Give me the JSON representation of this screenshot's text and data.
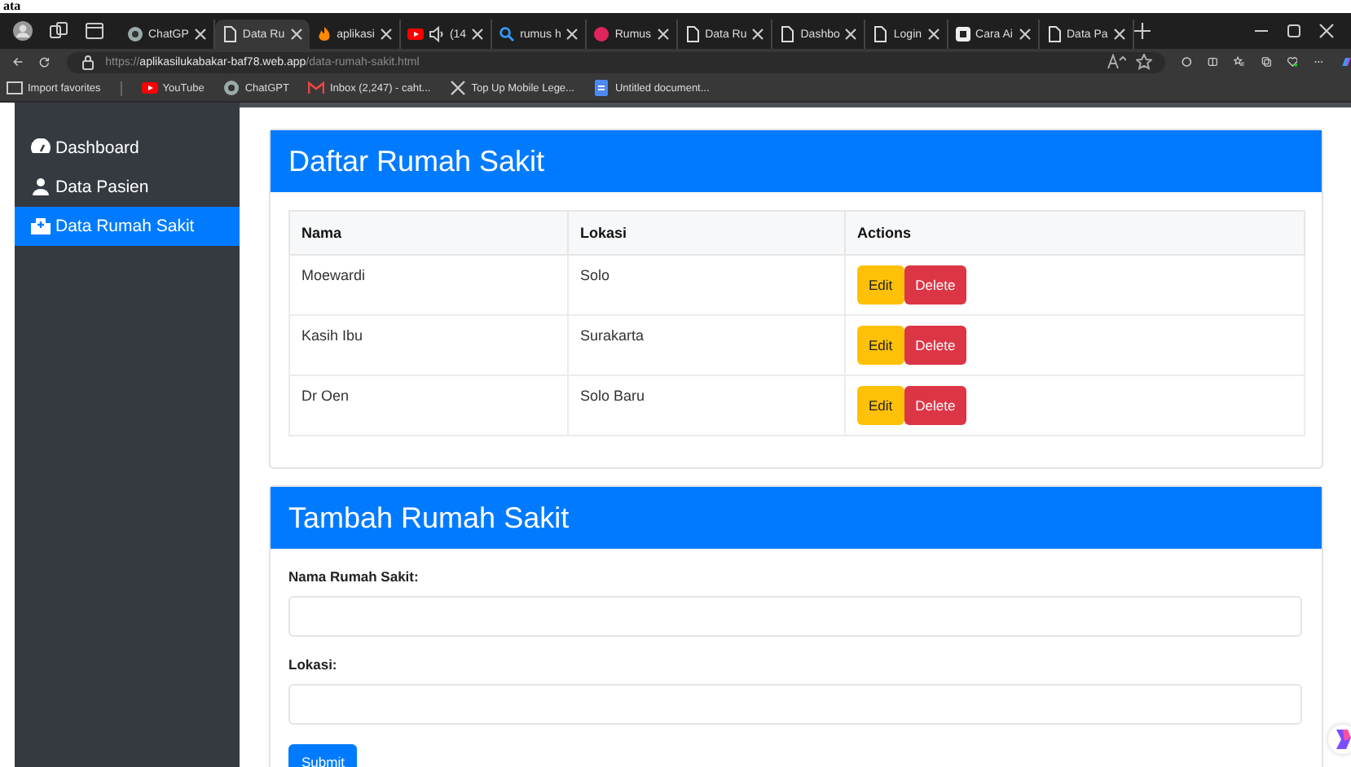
{
  "top_fragment": "ata",
  "browser": {
    "tabs": [
      {
        "label": "ChatGP",
        "selected": false
      },
      {
        "label": "Data Ru",
        "selected": true
      },
      {
        "label": "aplikasi",
        "selected": false
      },
      {
        "label": "(14",
        "selected": false
      },
      {
        "label": "rumus h",
        "selected": false
      },
      {
        "label": "Rumus",
        "selected": false
      },
      {
        "label": "Data Ru",
        "selected": false
      },
      {
        "label": "Dashbo",
        "selected": false
      },
      {
        "label": "Login",
        "selected": false
      },
      {
        "label": "Cara Ai",
        "selected": false
      },
      {
        "label": "Data Pa",
        "selected": false
      }
    ],
    "url": "https://**aplikasilukabakar-baf78.web.app**/data-rumah-sakit.html",
    "bookmarks": [
      {
        "label": "Import favorites"
      },
      {
        "label": "YouTube"
      },
      {
        "label": "ChatGPT"
      },
      {
        "label": "Inbox (2,247) - caht..."
      },
      {
        "label": "Top Up Mobile Lege..."
      },
      {
        "label": "Untitled document..."
      }
    ]
  },
  "sidebar": {
    "items": [
      {
        "label": "Dashboard",
        "selected": false
      },
      {
        "label": "Data Pasien",
        "selected": false
      },
      {
        "label": "Data Rumah Sakit",
        "selected": true
      }
    ]
  },
  "list_card": {
    "title": "Daftar Rumah Sakit",
    "columns": [
      "Nama",
      "Lokasi",
      "Actions"
    ],
    "rows": [
      {
        "nama": "Moewardi",
        "lokasi": "Solo",
        "actions": [
          "Edit",
          "Delete"
        ]
      },
      {
        "nama": "Kasih Ibu",
        "lokasi": "Surakarta",
        "actions": [
          "Edit",
          "Delete"
        ]
      },
      {
        "nama": "Dr Oen",
        "lokasi": "Solo Baru",
        "actions": [
          "Edit",
          "Delete"
        ]
      }
    ]
  },
  "form_card": {
    "title": "Tambah Rumah Sakit",
    "fields": [
      {
        "label": "Nama Rumah Sakit:"
      },
      {
        "label": "Lokasi:"
      }
    ],
    "submit": "Submit"
  }
}
